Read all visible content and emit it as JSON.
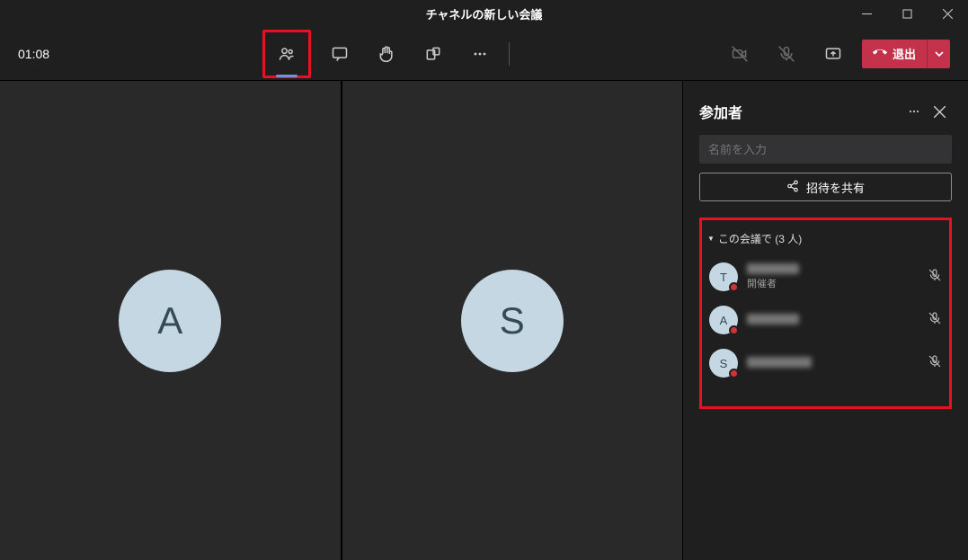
{
  "window": {
    "title": "チャネルの新しい会議"
  },
  "toolbar": {
    "timer": "01:08",
    "leave_label": "退出"
  },
  "panel": {
    "title": "参加者",
    "name_placeholder": "名前を入力",
    "share_label": "招待を共有",
    "section_label": "この会議で (3 人)",
    "participants": [
      {
        "initial": "T",
        "role": "開催者"
      },
      {
        "initial": "A",
        "role": ""
      },
      {
        "initial": "S",
        "role": ""
      }
    ]
  },
  "video": {
    "tiles": [
      {
        "initial": "A"
      },
      {
        "initial": "S"
      }
    ]
  }
}
